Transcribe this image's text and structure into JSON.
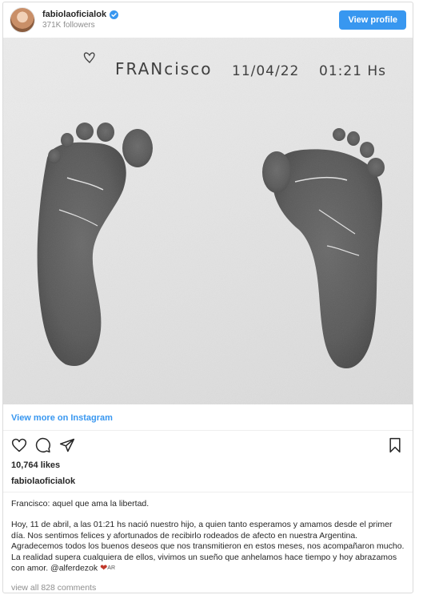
{
  "header": {
    "username": "fabiolaoficialok",
    "followers": "371K followers",
    "view_profile_label": "View profile"
  },
  "photo": {
    "name_text": "FRANcisco",
    "date_text": "11/04/22",
    "time_text": "01:21 Hs"
  },
  "view_more_label": "View more on Instagram",
  "likes": "10,764 likes",
  "poster": "fabiolaoficialok",
  "caption": {
    "line1": "Francisco: aquel que ama la libertad.",
    "body": "Hoy, 11 de abril, a las 01:21 hs nació nuestro hijo, a quien tanto esperamos y amamos desde el primer día. Nos sentimos felices y afortunados de recibirlo rodeados de afecto en nuestra Argentina. Agradecemos todos los buenos deseos que nos transmitieron en estos meses, nos acompañaron mucho. La realidad supera cualquiera de ellos, vivimos un sueño que anhelamos hace tiempo y hoy abrazamos con amor.",
    "mention": "@alferdezok",
    "flag": "AR"
  },
  "view_all_label": "view all 828 comments",
  "colors": {
    "accent": "#3897f0",
    "text": "#262626",
    "muted": "#8e8e8e"
  },
  "icons": [
    "verified-badge-icon",
    "heart-icon",
    "comment-icon",
    "share-icon",
    "bookmark-icon",
    "heart-emoji-icon"
  ]
}
